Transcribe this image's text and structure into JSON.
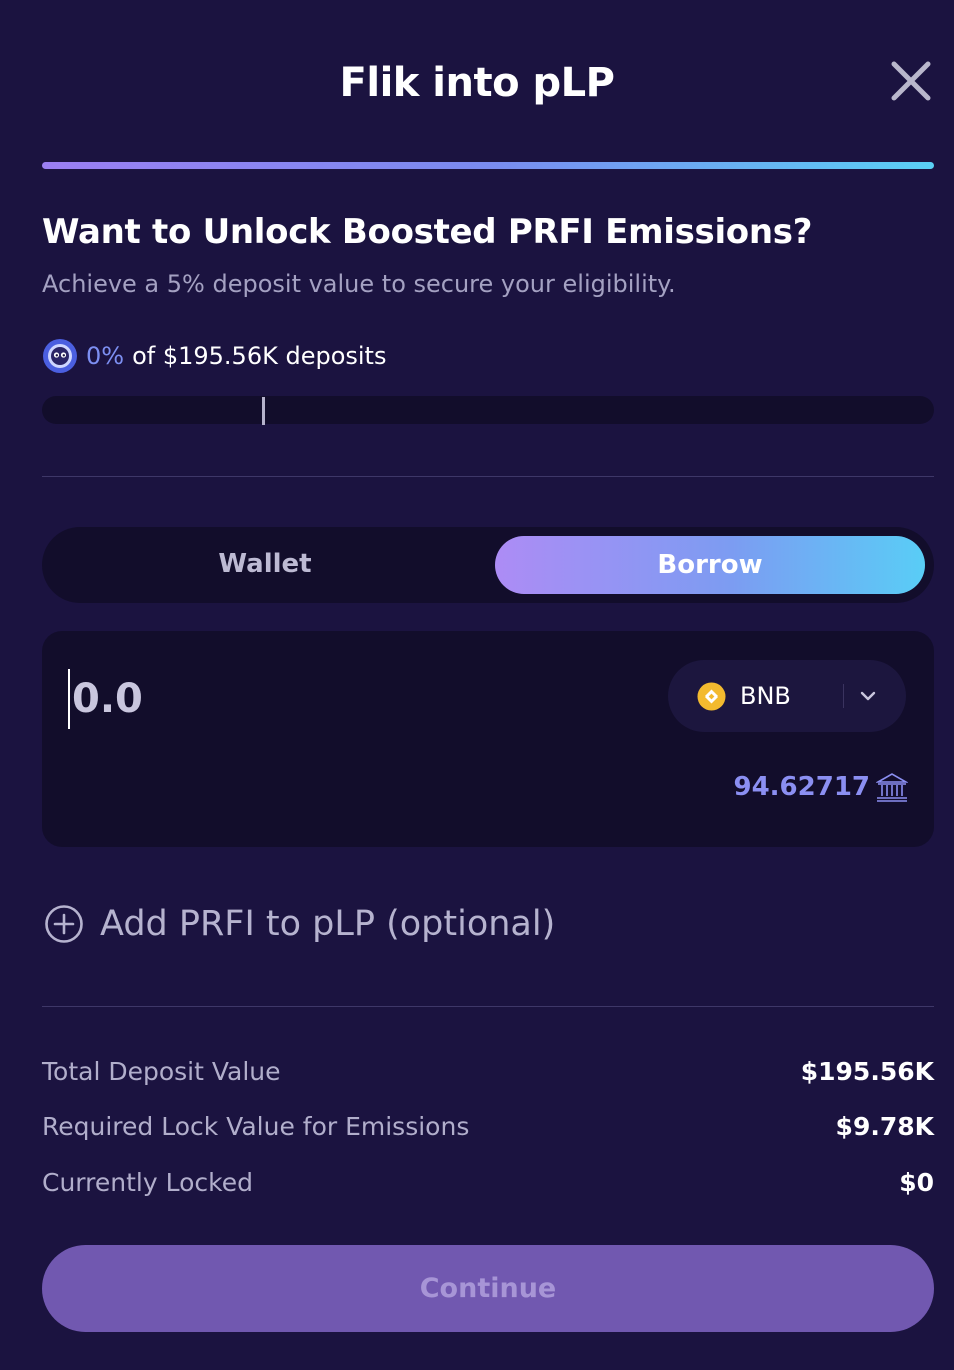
{
  "modal": {
    "title": "Flik into pLP",
    "close_icon": "close-icon"
  },
  "boost": {
    "heading": "Want to Unlock Boosted PRFI Emissions?",
    "subtitle": "Achieve a 5% deposit value to secure your eligibility.",
    "percent": "0%",
    "deposits_text": "of $195.56K deposits",
    "progress_fraction": 0,
    "target_marker_fraction": 0.25
  },
  "toggle": {
    "wallet_label": "Wallet",
    "borrow_label": "Borrow",
    "active": "Borrow"
  },
  "deposit_input": {
    "placeholder": "0.0",
    "value": "",
    "token": "BNB",
    "token_icon": "bnb-icon",
    "balance": "94.62717",
    "balance_icon": "bank-icon"
  },
  "add_prfi": {
    "label": "Add PRFI to pLP (optional)",
    "icon": "plus-circle-icon"
  },
  "summary": [
    {
      "label": "Total Deposit Value",
      "value": "$195.56K"
    },
    {
      "label": "Required Lock Value for Emissions",
      "value": "$9.78K"
    },
    {
      "label": "Currently Locked",
      "value": "$0"
    }
  ],
  "continue_label": "Continue",
  "colors": {
    "background": "#1b1340",
    "panel": "#120d2b",
    "accent_purple": "#9b7ff2",
    "accent_cyan": "#5ad0f5",
    "button_disabled": "#7158b0"
  }
}
